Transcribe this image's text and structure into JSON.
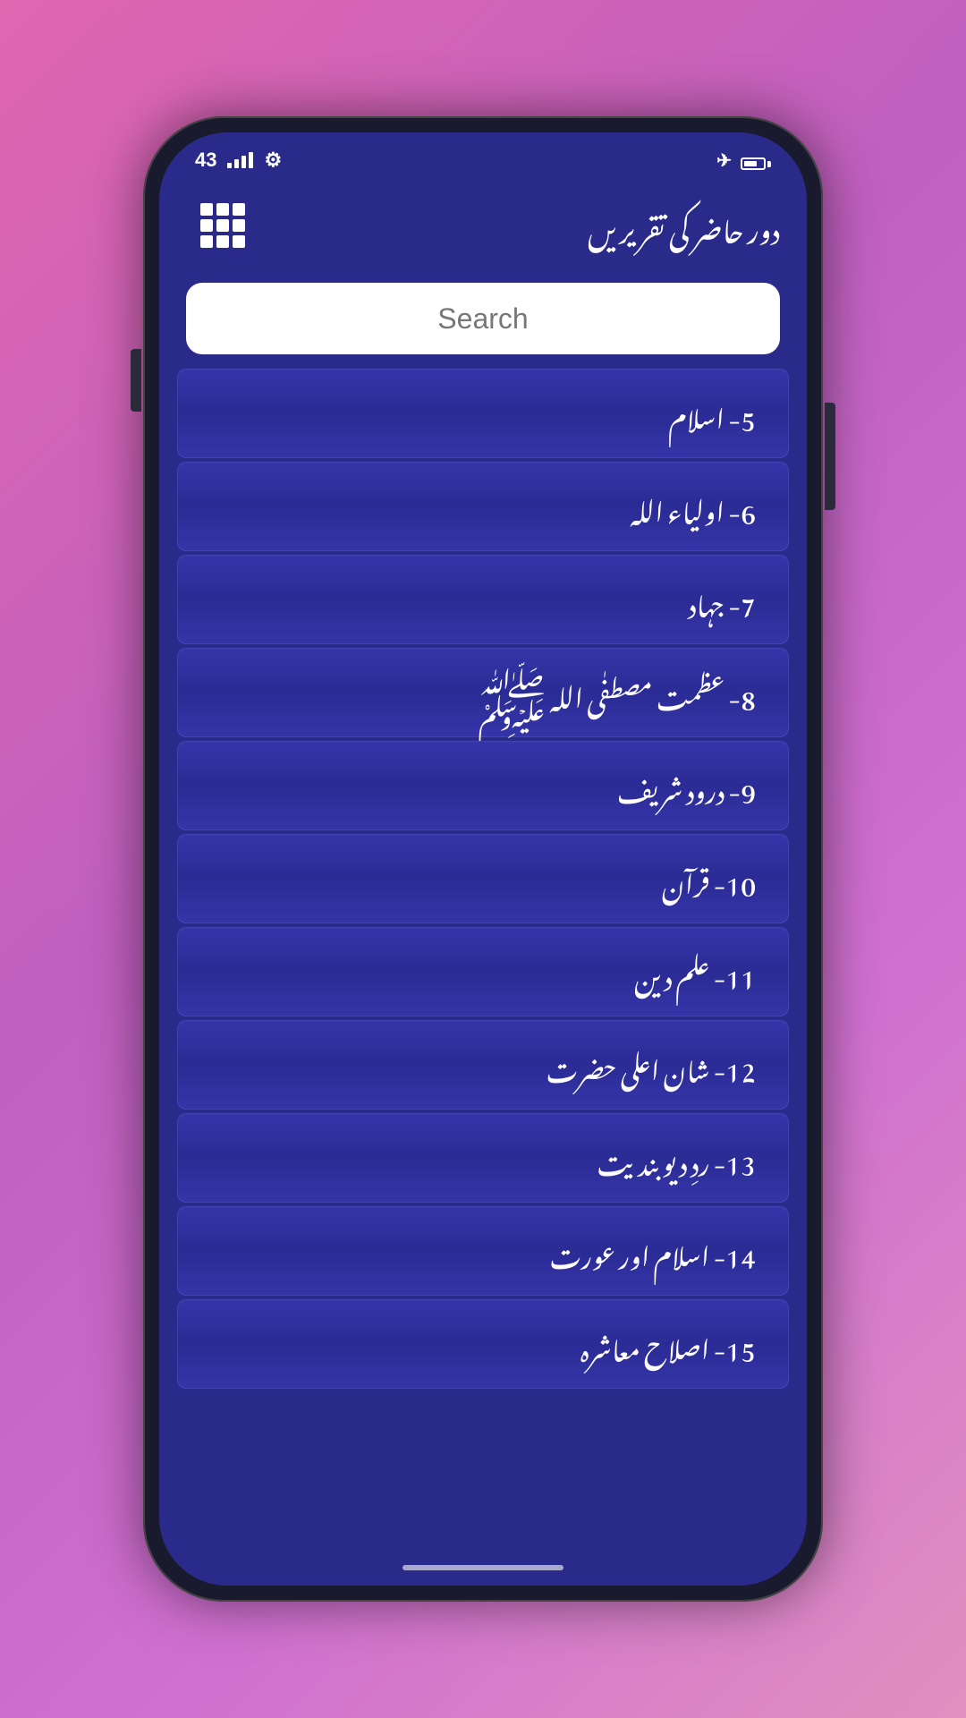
{
  "status": {
    "time": "43",
    "airplane_mode": true,
    "settings_icon": "⚙"
  },
  "header": {
    "title": "دور حاضر کی تقریریں",
    "grid_button_label": "Grid View"
  },
  "search": {
    "placeholder": "Search"
  },
  "list": {
    "items": [
      {
        "id": 5,
        "label": "5- اسلام"
      },
      {
        "id": 6,
        "label": "6- اولیاء اللہ"
      },
      {
        "id": 7,
        "label": "7- جہاد"
      },
      {
        "id": 8,
        "label": "8- عظمت مصطفٰی اللہ ﷺ"
      },
      {
        "id": 9,
        "label": "9- درود شریف"
      },
      {
        "id": 10,
        "label": "10- قرآن"
      },
      {
        "id": 11,
        "label": "11- علم دین"
      },
      {
        "id": 12,
        "label": "12- شان اعلی حضرت"
      },
      {
        "id": 13,
        "label": "13- ردِ دیوبندیت"
      },
      {
        "id": 14,
        "label": "14- اسلام اور عورت"
      },
      {
        "id": 15,
        "label": "15- اصلاح معاشرہ"
      }
    ]
  }
}
